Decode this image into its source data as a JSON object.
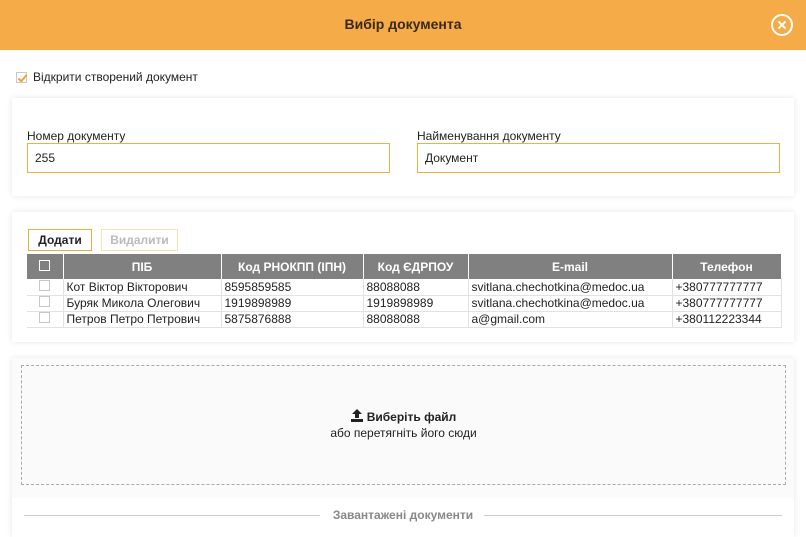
{
  "dialog": {
    "title": "Вибір документа",
    "header_color": "#f4ab48",
    "accent_color": "#f0b040"
  },
  "open_created": {
    "checked": true,
    "label": "Відкрити створений документ"
  },
  "fields": {
    "number": {
      "label": "Номер документу",
      "value": "255"
    },
    "name": {
      "label": "Найменування документу",
      "value": "Документ"
    }
  },
  "toolbar": {
    "add_label": "Додати",
    "delete_label": "Видалити"
  },
  "table": {
    "columns": [
      "ПІБ",
      "Код РНОКПП (ІПН)",
      "Код ЄДРПОУ",
      "E-mail",
      "Телефон"
    ],
    "rows": [
      [
        "Кот Віктор Вікторович",
        "8595859585",
        "88088088",
        "svitlana.chechotkina@medoc.ua",
        "+380777777777"
      ],
      [
        "Буряк Микола Олегович",
        "1919898989",
        "1919898989",
        "svitlana.chechotkina@medoc.ua",
        "+380777777777"
      ],
      [
        "Петров Петро Петрович",
        "5875876888",
        "88088088",
        "a@gmail.com",
        "+380112223344"
      ]
    ]
  },
  "upload": {
    "title": "Виберіть файл",
    "subtitle": "або перетягніть його сюди",
    "icon": "upload-icon"
  },
  "uploaded": {
    "label": "Завантажені документи"
  }
}
